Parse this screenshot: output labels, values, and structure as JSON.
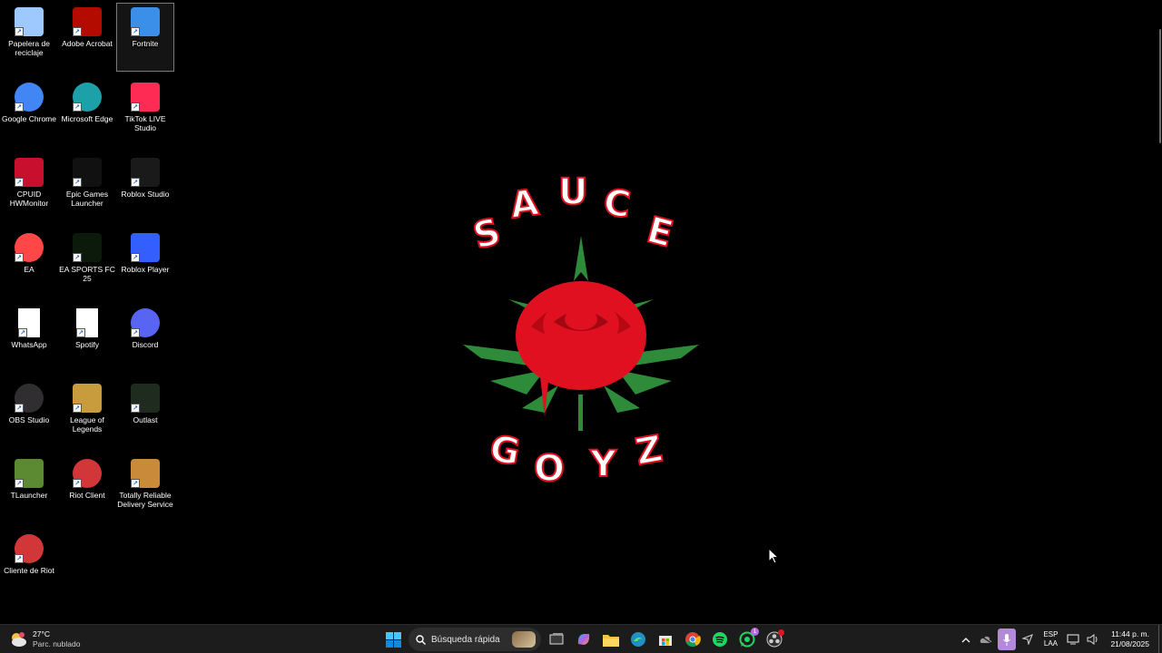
{
  "desktop": {
    "icons": [
      {
        "label": "Papelera de reciclaje",
        "icon": "recycle-bin-icon",
        "color": "#9ec9ff",
        "selected": false
      },
      {
        "label": "Adobe Acrobat",
        "icon": "acrobat-icon",
        "color": "#b30b00",
        "selected": false
      },
      {
        "label": "Fortnite",
        "icon": "fortnite-icon",
        "color": "#3b8fe8",
        "selected": true
      },
      {
        "label": "Google Chrome",
        "icon": "chrome-icon",
        "color": "#4285f4",
        "selected": false
      },
      {
        "label": "Microsoft Edge",
        "icon": "edge-icon",
        "color": "#1da1a8",
        "selected": false
      },
      {
        "label": "TikTok LIVE Studio",
        "icon": "tiktok-icon",
        "color": "#fe2c55",
        "selected": false
      },
      {
        "label": "CPUID HWMonitor",
        "icon": "hwmonitor-icon",
        "color": "#c8102e",
        "selected": false
      },
      {
        "label": "Epic Games Launcher",
        "icon": "epic-games-icon",
        "color": "#111111",
        "selected": false
      },
      {
        "label": "Roblox Studio",
        "icon": "roblox-studio-icon",
        "color": "#1a1a1a",
        "selected": false
      },
      {
        "label": "EA",
        "icon": "ea-icon",
        "color": "#ff4747",
        "selected": false
      },
      {
        "label": "EA SPORTS FC 25",
        "icon": "fc25-icon",
        "color": "#0b1a0b",
        "selected": false
      },
      {
        "label": "Roblox Player",
        "icon": "roblox-player-icon",
        "color": "#335fff",
        "selected": false
      },
      {
        "label": "WhatsApp",
        "icon": "blank-file-icon",
        "color": "#ffffff",
        "selected": false
      },
      {
        "label": "Spotify",
        "icon": "blank-file-icon",
        "color": "#ffffff",
        "selected": false
      },
      {
        "label": "Discord",
        "icon": "discord-icon",
        "color": "#5865f2",
        "selected": false
      },
      {
        "label": "OBS Studio",
        "icon": "obs-icon",
        "color": "#302e31",
        "selected": false
      },
      {
        "label": "League of Legends",
        "icon": "league-icon",
        "color": "#c89b3c",
        "selected": false
      },
      {
        "label": "Outlast",
        "icon": "outlast-icon",
        "color": "#1f2b1f",
        "selected": false
      },
      {
        "label": "TLauncher",
        "icon": "tlauncher-icon",
        "color": "#5b8a32",
        "selected": false
      },
      {
        "label": "Riot Client",
        "icon": "riot-icon",
        "color": "#d13639",
        "selected": false
      },
      {
        "label": "Totally Reliable Delivery Service",
        "icon": "trds-icon",
        "color": "#c98a3a",
        "selected": false
      },
      {
        "label": "Cliente de Riot",
        "icon": "riot-icon",
        "color": "#d13639",
        "selected": false
      }
    ]
  },
  "wallpaper": {
    "letters_top": "SAUCE",
    "letters_bottom": "GOYZ",
    "rose_color": "#e01020",
    "leaf_color": "#2e8b3a"
  },
  "taskbar": {
    "weather": {
      "temp": "27°C",
      "condition": "Parc. nublado"
    },
    "search": {
      "placeholder": "Búsqueda rápida"
    },
    "apps": [
      {
        "name": "start-button",
        "icon": "windows-icon"
      },
      {
        "name": "task-view",
        "icon": "task-view-icon"
      },
      {
        "name": "copilot",
        "icon": "copilot-icon"
      },
      {
        "name": "file-explorer",
        "icon": "folder-icon"
      },
      {
        "name": "edge",
        "icon": "edge-icon"
      },
      {
        "name": "store",
        "icon": "store-icon"
      },
      {
        "name": "chrome",
        "icon": "chrome-icon"
      },
      {
        "name": "spotify",
        "icon": "spotify-icon"
      },
      {
        "name": "whatsapp",
        "icon": "whatsapp-icon",
        "badge": "1"
      },
      {
        "name": "obs",
        "icon": "obs-icon"
      }
    ],
    "tray": {
      "lang_top": "ESP",
      "lang_bottom": "LAA",
      "time": "11:44 p. m.",
      "date": "21/08/2025"
    }
  }
}
